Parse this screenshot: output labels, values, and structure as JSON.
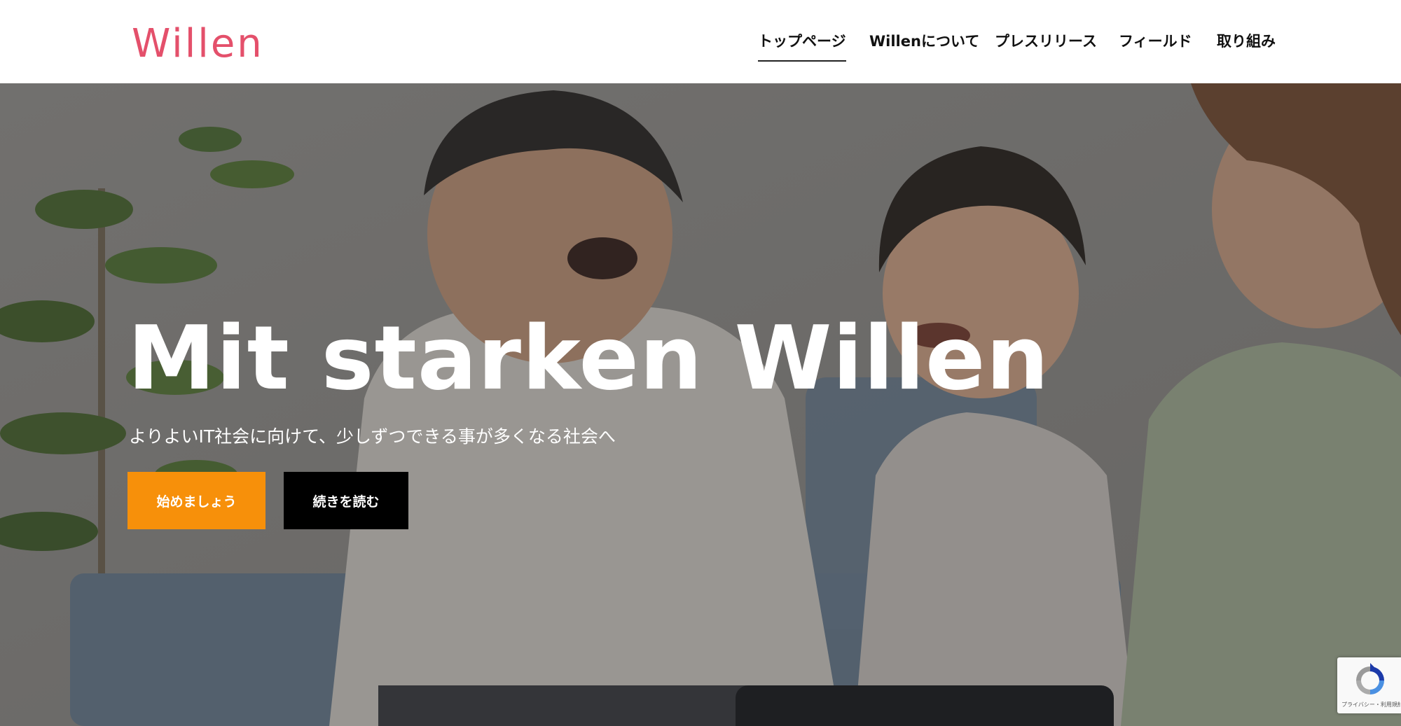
{
  "brand": {
    "logo_text": "Willen",
    "logo_color": "#e4506b"
  },
  "nav": {
    "items": [
      {
        "label": "トップページ",
        "active": true
      },
      {
        "label": "Willenについて",
        "active": false
      },
      {
        "label": "プレスリリース",
        "active": false
      },
      {
        "label": "フィールド",
        "active": false
      },
      {
        "label": "取り組み",
        "active": false
      }
    ]
  },
  "hero": {
    "title": "Mit starken Willen",
    "subtitle": "よりよいIT社会に向けて、少しずつできる事が多くなる社会へ",
    "primary_button": {
      "label": "始めましょう",
      "color": "#f7900a"
    },
    "secondary_button": {
      "label": "続きを読む",
      "color": "#000000"
    },
    "image_description_icons": [
      "plant-icon",
      "family-photo"
    ]
  },
  "recaptcha": {
    "text": "プライバシー・利用規約",
    "icon": "recaptcha-icon"
  }
}
